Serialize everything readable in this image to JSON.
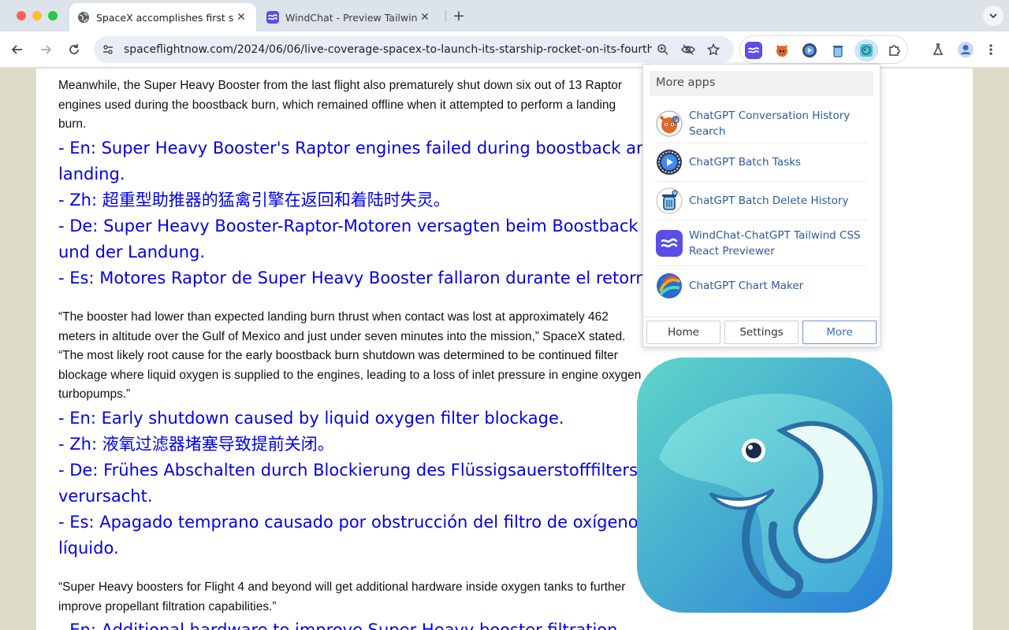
{
  "browser": {
    "tabs": [
      {
        "title": "SpaceX accomplishes first sc",
        "active": true,
        "favicon": "globe-icon"
      },
      {
        "title": "WindChat - Preview Tailwind",
        "active": false,
        "favicon": "windchat-icon"
      }
    ],
    "url": "spaceflightnow.com/2024/06/06/live-coverage-spacex-to-launch-its-starship-rocket-on-its-fourth..."
  },
  "article": {
    "paragraphs": [
      {
        "text": "Meanwhile, the Super Heavy Booster from the last flight also prematurely shut down six out of 13 Raptor engines used during the boostback burn, which remained offline when it attempted to perform a landing burn.",
        "translations": [
          "- En: Super Heavy Booster's Raptor engines failed during boostback and",
          "landing.",
          "- Zh: 超重型助推器的猛禽引擎在返回和着陆时失灵。",
          "- De: Super Heavy Booster-Raptor-Motoren versagten beim Boostback",
          "und der Landung.",
          "- Es: Motores Raptor de Super Heavy Booster fallaron durante el retorno."
        ]
      },
      {
        "text": "“The booster had lower than expected landing burn thrust when contact was lost at approximately 462 meters in altitude over the Gulf of Mexico and just under seven minutes into the mission,” SpaceX stated. “The most likely root cause for the early boostback burn shutdown was determined to be continued filter blockage where liquid oxygen is supplied to the engines, leading to a loss of inlet pressure in engine oxygen turbopumps.”",
        "translations": [
          "- En: Early shutdown caused by liquid oxygen filter blockage.",
          "- Zh: 液氧过滤器堵塞导致提前关闭。",
          "- De: Frühes Abschalten durch Blockierung des Flüssigsauerstofffilters",
          "verursacht.",
          "- Es: Apagado temprano causado por obstrucción del filtro de oxígeno",
          "líquido."
        ]
      },
      {
        "text": "“Super Heavy boosters for Flight 4 and beyond will get additional hardware inside oxygen tanks to further improve propellant filtration capabilities.”",
        "translations": [
          "- En: Additional hardware to improve Super Heavy booster filtration."
        ]
      }
    ]
  },
  "popup": {
    "header": "More apps",
    "apps": [
      {
        "name": "ChatGPT Conversation History Search",
        "line1": "ChatGPT Conversation History",
        "line2": "Search",
        "icon": "fox-icon"
      },
      {
        "name": "ChatGPT Batch Tasks",
        "line1": "ChatGPT Batch Tasks",
        "line2": "",
        "icon": "play-badge-icon"
      },
      {
        "name": "ChatGPT Batch Delete History",
        "line1": "ChatGPT Batch Delete History",
        "line2": "",
        "icon": "trash-robot-icon"
      },
      {
        "name": "WindChat-ChatGPT Tailwind CSS React Previewer",
        "line1": "WindChat-ChatGPT Tailwind CSS",
        "line2": "React Previewer",
        "icon": "windchat-icon"
      },
      {
        "name": "ChatGPT Chart Maker",
        "line1": "ChatGPT Chart Maker",
        "line2": "",
        "icon": "chart-swirl-icon"
      }
    ],
    "footer": {
      "home": "Home",
      "settings": "Settings",
      "more": "More"
    }
  },
  "colors": {
    "link_blue": "#0000ee",
    "accent": "#3a6fc7",
    "app_name": "#2d5aa0",
    "windchat": "#5b4ee6"
  }
}
